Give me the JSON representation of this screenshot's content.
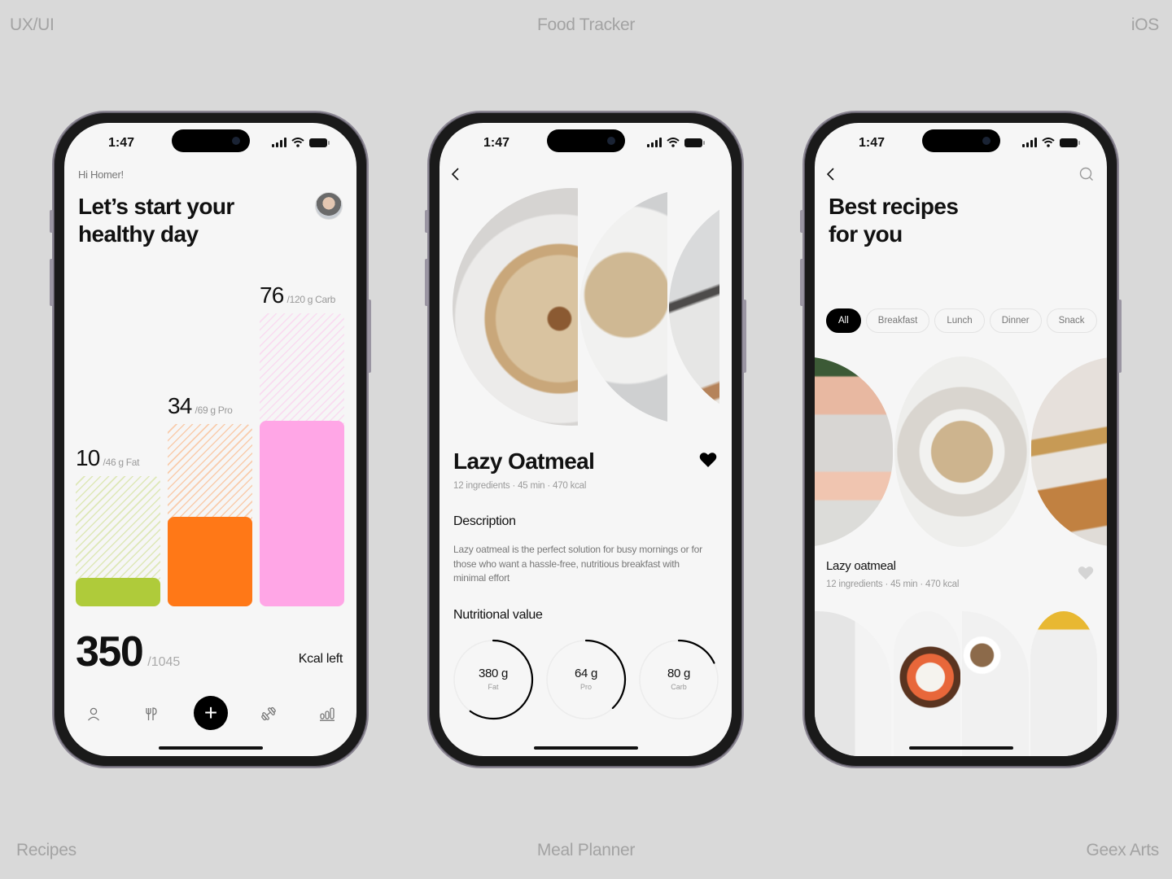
{
  "labels": {
    "top_left": "UX/UI",
    "top_center": "Food Tracker",
    "top_right": "iOS",
    "bottom_left": "Recipes",
    "bottom_center": "Meal Planner",
    "bottom_right": "Geex Arts"
  },
  "status": {
    "time": "1:47"
  },
  "colors": {
    "fat": "#AFCB3A",
    "protein": "#FF7817",
    "carb": "#FFA6E6"
  },
  "dashboard": {
    "greeting": "Hi Homer!",
    "title_line1": "Let’s start your",
    "title_line2": "healthy day",
    "macros": [
      {
        "value": "10",
        "goal": "/46 g Fat",
        "current": 10,
        "target": 46
      },
      {
        "value": "34",
        "goal": "/69 g Pro",
        "current": 34,
        "target": 69
      },
      {
        "value": "76",
        "goal": "/120 g Carb",
        "current": 76,
        "target": 120
      }
    ],
    "kcal_value": "350",
    "kcal_total": "/1045",
    "kcal_label": "Kcal left",
    "tabs": [
      "profile-icon",
      "food-icon",
      "add-icon",
      "workout-icon",
      "stats-icon"
    ],
    "add_label": "+"
  },
  "recipe": {
    "title": "Lazy Oatmeal",
    "meta": "12 ingredients · 45 min · 470 kcal",
    "description_heading": "Description",
    "description": "Lazy oatmeal is the perfect solution for busy mornings or for those who want a hassle-free, nutritious breakfast with minimal effort",
    "nutrition_heading": "Nutritional value",
    "nutrition": [
      {
        "value": "380 g",
        "label": "Fat",
        "progress": 0.6
      },
      {
        "value": "64 g",
        "label": "Pro",
        "progress": 0.38
      },
      {
        "value": "80 g",
        "label": "Carb",
        "progress": 0.18
      }
    ],
    "favorited": true
  },
  "recipes_list": {
    "title_line1": "Best recipes",
    "title_line2": "for you",
    "filters": [
      "All",
      "Breakfast",
      "Lunch",
      "Dinner",
      "Snack"
    ],
    "active_filter": "All",
    "items": [
      {
        "title": "Lazy oatmeal",
        "meta": "12 ingredients · 45 min · 470 kcal",
        "favorited": false
      }
    ]
  }
}
